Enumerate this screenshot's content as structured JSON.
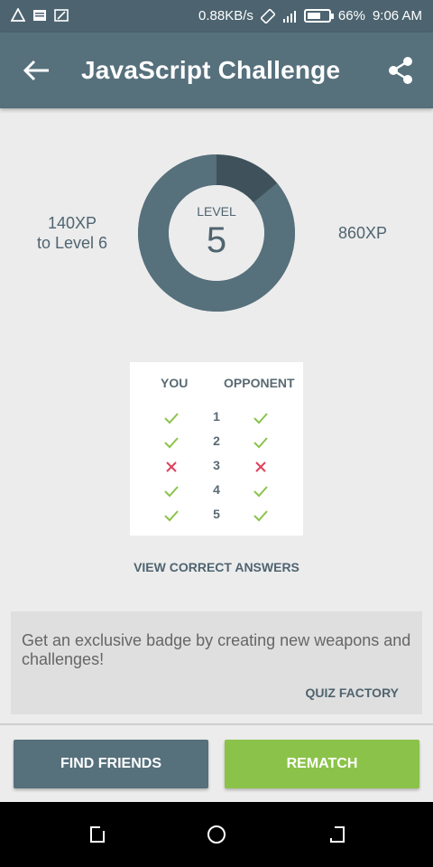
{
  "status_bar": {
    "speed": "0.88KB/s",
    "battery": "66%",
    "battery_level": 0.66,
    "time": "9:06 AM"
  },
  "app_bar": {
    "title": "JavaScript Challenge",
    "back_icon": "arrow-left-icon",
    "share_icon": "share-icon"
  },
  "level": {
    "label": "LEVEL",
    "number": "5",
    "xp_left_line1": "140XP",
    "xp_left_line2": "to Level 6",
    "xp_right": "860XP",
    "progress_fraction": 0.86
  },
  "results": {
    "you_header": "YOU",
    "opponent_header": "OPPONENT",
    "rows": [
      {
        "num": "1",
        "you": "correct",
        "opponent": "correct"
      },
      {
        "num": "2",
        "you": "correct",
        "opponent": "correct"
      },
      {
        "num": "3",
        "you": "wrong",
        "opponent": "wrong"
      },
      {
        "num": "4",
        "you": "correct",
        "opponent": "correct"
      },
      {
        "num": "5",
        "you": "correct",
        "opponent": "correct"
      }
    ]
  },
  "view_answers": "VIEW CORRECT ANSWERS",
  "promo": {
    "text": "Get an exclusive badge by creating new weapons and challenges!",
    "link": "QUIZ FACTORY"
  },
  "buttons": {
    "find_friends": "FIND FRIENDS",
    "rematch": "REMATCH"
  },
  "colors": {
    "primary": "#56707c",
    "accent_green": "#8bc34a",
    "check_green": "#8bc34a",
    "cross_red": "#e0405a"
  }
}
